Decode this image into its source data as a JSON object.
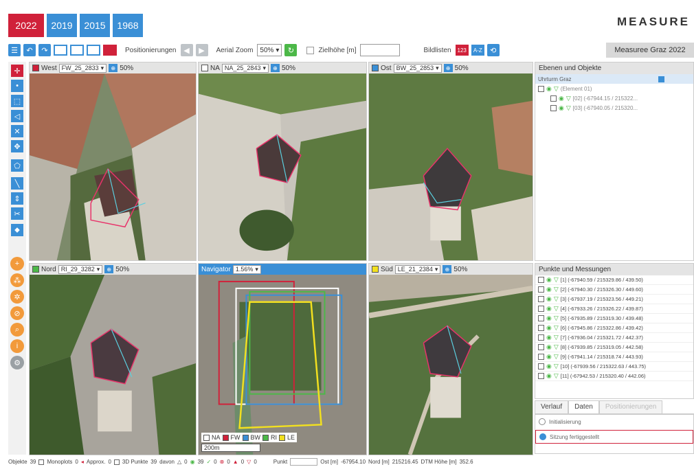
{
  "brand": "MEASURE",
  "years": [
    "2022",
    "2019",
    "2015",
    "1968"
  ],
  "toolbar": {
    "positions_label": "Positionierungen",
    "aerial_zoom_label": "Aerial Zoom",
    "aerial_zoom_value": "50%",
    "target_height_label": "Zielhöhe [m]",
    "image_lists_label": "Bildlisten",
    "badge_red": "123",
    "badge_blue": "A-Z",
    "project_name": "Measuree Graz 2022"
  },
  "viewports": {
    "west": {
      "label": "West",
      "image": "FW_25_2833",
      "zoom": "50%",
      "color": "#d0213a"
    },
    "na": {
      "label": "NA",
      "image": "NA_25_2843",
      "zoom": "50%",
      "color": "#ffffff"
    },
    "ost": {
      "label": "Ost",
      "image": "BW_25_2853",
      "zoom": "50%",
      "color": "#3a8fd6"
    },
    "nord": {
      "label": "Nord",
      "image": "RI_29_3282",
      "zoom": "50%",
      "color": "#4cb848"
    },
    "navigator": {
      "label": "Navigator",
      "zoom": "1.56%"
    },
    "sued": {
      "label": "Süd",
      "image": "LE_21_2384",
      "zoom": "50%",
      "color": "#f2e01f"
    }
  },
  "navigator_legend": [
    {
      "label": "NA",
      "color": "#ffffff"
    },
    {
      "label": "FW",
      "color": "#d0213a"
    },
    {
      "label": "BW",
      "color": "#3a8fd6"
    },
    {
      "label": "RI",
      "color": "#4cb848"
    },
    {
      "label": "LE",
      "color": "#f2e01f"
    }
  ],
  "navigator_scale": "200m",
  "layers_panel": {
    "title": "Ebenen und Objekte",
    "rows": [
      "Uhrturm Graz",
      "(Element 01)",
      "[02] (-67944.15 / 215322...",
      "[03] (-67940.05 / 215320..."
    ]
  },
  "points_panel": {
    "title": "Punkte und Messungen",
    "rows": [
      "[1] (-67940.59 / 215329.86 / 439.50)",
      "[2] (-67940.30 / 215326.30 / 449.60)",
      "[3] (-67937.19 / 215323.56 / 449.21)",
      "[4] (-67933.26 / 215326.22 / 439.87)",
      "[5] (-67935.89 / 215319.30 / 439.48)",
      "[6] (-67945.86 / 215322.86 / 439.42)",
      "[7] (-67936.04 / 215321.72 / 442.37)",
      "[8] (-67939.85 / 215319.05 / 442.58)",
      "[9] (-67941.14 / 215318.74 / 443.93)",
      "[10] (-67939.56 / 215322.63 / 443.75)",
      "[11] (-67942.53 / 215320.40 / 442.06)"
    ]
  },
  "bottom_tabs": [
    "Verlauf",
    "Daten",
    "Positionierungen"
  ],
  "log": [
    "Initialisierung",
    "Sitzung fertiggestellt"
  ],
  "statusbar": {
    "objects_label": "Objekte",
    "objects_value": "39",
    "monoplots_label": "Monoplots",
    "monoplots_value": "0",
    "approx_label": "Approx.",
    "approx_value": "0",
    "points3d_label": "3D Punkte",
    "points3d_value": "39",
    "davon_label": "davon",
    "c1": "0",
    "c2": "39",
    "c3": "0",
    "c4": "0",
    "c5": "0",
    "c6": "0",
    "punkt_label": "Punkt",
    "ost_label": "Ost [m]",
    "ost_value": "-67954.10",
    "nord_label": "Nord [m]",
    "nord_value": "215216.45",
    "dtm_label": "DTM Höhe [m]",
    "dtm_value": "352.6"
  }
}
